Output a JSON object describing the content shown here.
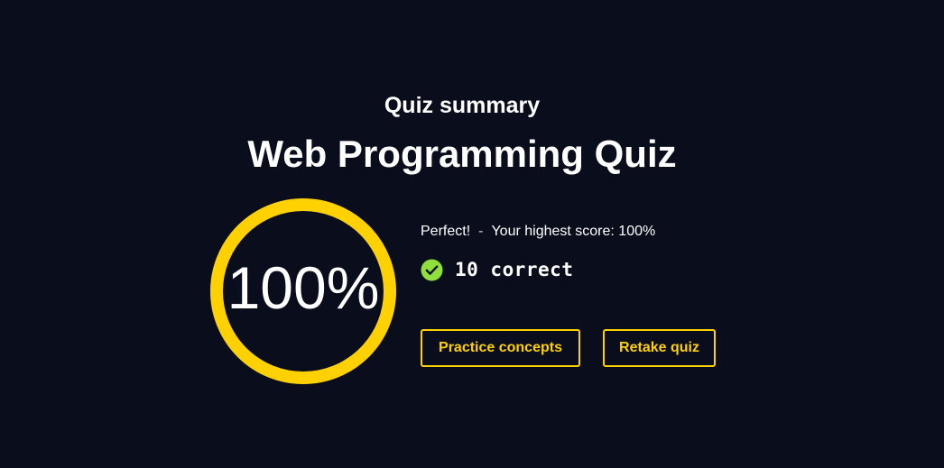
{
  "header": {
    "subtitle": "Quiz summary",
    "title": "Web Programming Quiz"
  },
  "score": {
    "percent_label": "100%",
    "fraction": 1.0,
    "ring_color": "#ffd100"
  },
  "result": {
    "status": "Perfect!",
    "separator": "-",
    "highest_score": "Your highest score: 100%",
    "correct_label": "10 correct",
    "check_icon": "check-circle-icon",
    "check_color": "#8fe03c"
  },
  "actions": {
    "practice_label": "Practice concepts",
    "retake_label": "Retake quiz"
  },
  "colors": {
    "background": "#0a0d1c",
    "accent": "#ffd100"
  }
}
